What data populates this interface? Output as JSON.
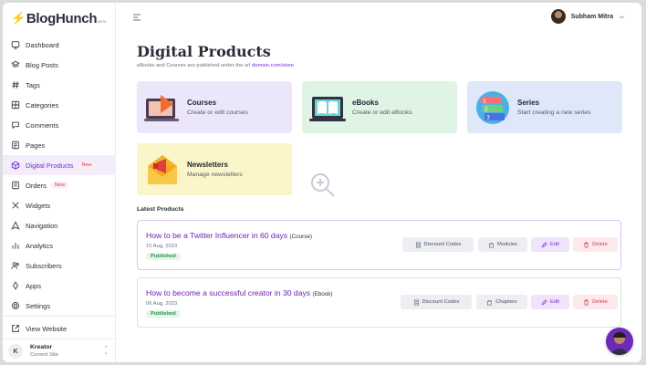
{
  "brand": {
    "name": "BlogHunch",
    "tag": "BETA",
    "accent": "#7a2ec8"
  },
  "sidebar": {
    "items": [
      {
        "label": "Dashboard",
        "icon": "dashboard-icon"
      },
      {
        "label": "Blog Posts",
        "icon": "layers-icon"
      },
      {
        "label": "Tags",
        "icon": "hash-icon"
      },
      {
        "label": "Categories",
        "icon": "grid-icon"
      },
      {
        "label": "Comments",
        "icon": "comment-icon"
      },
      {
        "label": "Pages",
        "icon": "page-icon"
      },
      {
        "label": "Digital Products",
        "icon": "box-icon",
        "badge": "New",
        "active": true
      },
      {
        "label": "Orders",
        "icon": "receipt-icon",
        "badge": "New"
      },
      {
        "label": "Widgets",
        "icon": "tools-icon"
      },
      {
        "label": "Navigation",
        "icon": "navigation-icon"
      },
      {
        "label": "Analytics",
        "icon": "bar-chart-icon"
      },
      {
        "label": "Subscribers",
        "icon": "users-icon"
      },
      {
        "label": "Apps",
        "icon": "apps-icon"
      },
      {
        "label": "Settings",
        "icon": "gear-icon"
      }
    ],
    "view_website": "View Website",
    "site": {
      "initial": "K",
      "name": "Kreator",
      "sub": "Current Site"
    }
  },
  "topbar": {
    "user_name": "Subham Mitra"
  },
  "main": {
    "title": "Digital Products",
    "subtitle_prefix": "eBooks and Courses are published under the url",
    "subtitle_link": "domain.com/store",
    "cards": [
      {
        "title": "Courses",
        "desc": "Create or edit courses",
        "bg": "#ece6fa"
      },
      {
        "title": "eBooks",
        "desc": "Create or edit eBooks",
        "bg": "#dff4e4"
      },
      {
        "title": "Series",
        "desc": "Start creating a new series",
        "bg": "#dfe8f8"
      },
      {
        "title": "Newsletters",
        "desc": "Manage newsletters",
        "bg": "#faf6c9"
      }
    ],
    "latest_label": "Latest Products",
    "products": [
      {
        "title": "How to be a Twitter Influencer in 60 days",
        "type": "(Course)",
        "date": "10 Aug, 2023",
        "status": "Published",
        "buttons": [
          "Discount Codes",
          "Modules",
          "Edit",
          "Delete"
        ],
        "border": "#d8c6f2"
      },
      {
        "title": "How to become a successful creator in 30 days",
        "type": "(Ebook)",
        "date": "06 Aug, 2023",
        "status": "Published",
        "buttons": [
          "Discount Codes",
          "Chapters",
          "Edit",
          "Delete"
        ],
        "border": "#c9ecd3"
      }
    ]
  }
}
